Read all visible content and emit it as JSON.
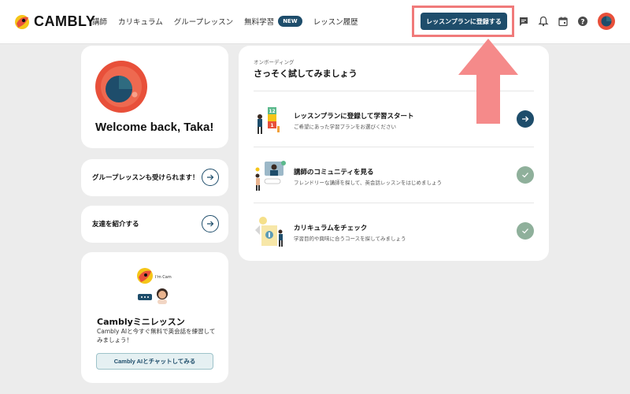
{
  "header": {
    "logo_text": "CAMBLY",
    "nav": [
      {
        "label": "講師"
      },
      {
        "label": "カリキュラム"
      },
      {
        "label": "グループレッスン"
      },
      {
        "label": "無料学習"
      },
      {
        "label": "レッスン履歴"
      }
    ],
    "new_badge": "NEW",
    "cta_label": "レッスンプランに登録する",
    "icons": [
      "chat-icon",
      "bell-icon",
      "calendar-icon",
      "help-icon",
      "avatar"
    ]
  },
  "welcome": {
    "text": "Welcome back, Taka!"
  },
  "group_lesson": {
    "label": "グループレッスンも受けられます！"
  },
  "refer": {
    "label": "友達を紹介する"
  },
  "mini_lesson": {
    "bubble_text": "I'm Cam",
    "title": "Camblyミニレッスン",
    "description": "Cambly AIと今すぐ無料で英会話を練習してみましょう！",
    "button_label": "Cambly AIとチャットしてみる"
  },
  "onboarding": {
    "eyebrow": "オンボーディング",
    "title": "さっそく試してみましょう",
    "tasks": [
      {
        "title": "レッスンプランに登録して学習スタート",
        "desc": "ご希望にあった学習プランをお選びください",
        "status": "pending"
      },
      {
        "title": "講師のコミュニティを見る",
        "desc": "フレンドリーな講師を探して、英会話レッスンをはじめましょう",
        "status": "done"
      },
      {
        "title": "カリキュラムをチェック",
        "desc": "学習目的や興味に合うコースを探してみましょう",
        "status": "done"
      }
    ],
    "illus_numbers": [
      "12",
      "1"
    ]
  },
  "colors": {
    "primary": "#1e4d6b",
    "highlight": "#f07a7a",
    "done": "#8fb09b",
    "brand_red": "#e8503a",
    "brand_yellow": "#f5c518"
  }
}
